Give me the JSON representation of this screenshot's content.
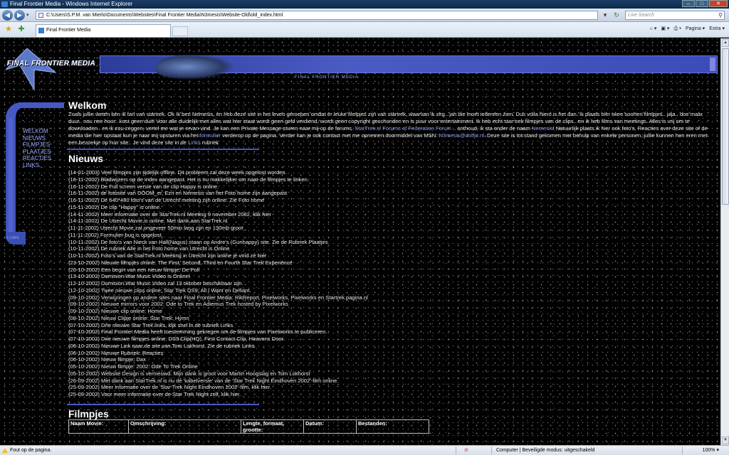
{
  "window": {
    "title": "Final Frontier Media - Windows Internet Explorer",
    "min": "–",
    "max": "□",
    "close": "✕"
  },
  "address": {
    "url": "C:\\Users\\S.P.M. van Mierlo\\Documents\\Websites\\Final Frontier Media\\N3mesis\\Website-Old\\old_index.html",
    "search_placeholder": "Live Search"
  },
  "tab": {
    "label": "Final Frontier Media"
  },
  "tools": {
    "page": "Pagina ▾",
    "extra": "Extra ▾"
  },
  "site": {
    "logo_text": "FINAL FRONTIER MEDIA",
    "banner_text": "FINAL FRONTIER MEDIA",
    "nav": [
      "WELKOM",
      "NIEUWS",
      "FILMPJES",
      "PLAATJES",
      "REACTIES",
      "LINKS"
    ],
    "lcars_label": "LCARS"
  },
  "welkom": {
    "title": "Welkom",
    "text1": "Zoals jullie weten ben ik fan van startrek. Ok Ik ben Nemesis, en heb deze site in het leven geroepen omdat er leuke filmpjes zijn van startrek, waarvan ik zeg.. jah die moet iedereen zien. Dus voila hiero is het dan. Ik plaats hier twee soorten filmpjes.. jaja.. doe maar duur.. nou nee hoor.. kost geen duit! Voor alle duidelijk met alles wat hier staat wordt geen geld verdiend, wordt geen copyright geschonden en is puur voor entertainment. Ik heb echt star trek filmpjes van de clips.. en ik heb films van meetings. Alles is vrij om te downloaden.. en ik zou zeggen, vertel me wat je ervan vind. Je kan een Private Message sturen naar mij op de forums. ",
    "link1": "StarTrek.nl Forums of Federation Forum",
    "text2": " .. onthoud, ik sta onder de naam ",
    "link2": "Nemesis",
    "text3": "! Natuurlijk plaats ik hier ook foto's. Reacties over deze site of de media die hier opstaat kun je naar mij opsturen via het ",
    "link3": "formulier",
    "text4": " verderop op de pagina. Verder kan je ook contact met me opnemen doormiddel van MSN: ",
    "link4": "N3mesis@dolfjn.nl",
    "text5": ". Deze site is tot stand gekomen met behulp van enkele personen, jullie kunnen hen eren met een bezoekje op hun site.. Je vind deze site in de ",
    "link5": "Links",
    "text6": " rubriek"
  },
  "nieuws": {
    "title": "Nieuws",
    "items": [
      "(14-01-2003) Veel filmpjes zijn tijdelijk offline. Dit probleem zal deze week opgelost worden.",
      "(16-11-2002) Bladwijzers op de index aangepast. Het is nu makkelijker om naar de filmpjes te linken.",
      "(16-11-2002) De Full screen versie van de clip Happy is online.",
      "(16-11-2002) de fotosite van DOOM_er, Ezri en Nemesis van het Foto home zijn aangepast",
      "(16-11-2002) De 640*480 foto's van de Utrecht meeting zijn online. Zie Foto home",
      "(15-11-2002) De clip \"Happy\" is online.",
      "(14-11-2002) Meer informatie over de StarTrek.nl Meeting 9 november 2002, klik hier",
      "(14-11-2002) De Utrecht Movie is online. Met dank aan StarTrek.nl",
      "(11-11-2002) Utrecht Movie zal ongeveer 50min lang zijn en 130mb groot",
      "(11-11-2002) Formulier-bug is opgelost.",
      "(10-11-2002) De foto's van Nieck van Hall(Nagus) staan op Andre's (Gunhappy) site. Zie de Rubriek Plaatjes",
      "(10-11-2002) De rubriek Alle in het Foto home van Utrecht is Online",
      "(10-11-2002) Foto's van de StarTrek.nl Meeting in Utrecht zijn online je vind ze hier",
      "(23-10-2002) Nieuwe filmpjes online: The First, Second, Third en Fourth Star Trek Experience",
      "(20-10-2002) Een begin van een nieuw filmpje: De Poll",
      "(13-10-2002) Dominion War Music Video is Online!",
      "(12-10-2002) Dominion War Music Video zal 13 oktober beschikbaar zijn.",
      "(12-10-2002) Twee nieuwe clips online: Star Trek DS9: All I Want en Defiant.",
      "(09-10-2002) Verwijzingen op andere sites naar Final Frontier Media: RikReport, Pixelworks, Pixelworks en Startrek.pagina.nl",
      "(09-10-2002) Nieuwe mirrors voor 2002: Ode to Trek en Adiemus Trek hosted by Pixelworks",
      "(09-10-2002) Nieuwe clip online: Home",
      "(08-10-2002) Nieuw Clipje online: Star Trek: Hymn",
      "(07-10-2002) Drie nieuwe Star Trek links, kijk snel in de rubriek Links",
      "(07-10-2002) Final Frontier Media heeft toestemming gekregen om de filmpjes van Pixelworks te publiceren.",
      "(07-10-2002) Drie nieuwe filmpjes online: DS9 Clip(HQ), First Contact Clip, Heavens Door.",
      "(06-10-2002) Nieuwe Link naar de site van Tom Lokhorst. Zie de rubriek Links",
      "(06-10-2002) Nieuwe Rubriek: Reacties",
      "(06-10-2002) Nieuw filmpje: Dax",
      "(05-10-2002) Nieuw filmpje: 2002: Ode To Trek Online",
      "(05-10-2002) Website Design is vernieuwd. Mijn dank is groot voor Martin Hoogslag en Tom Lokhorst",
      "(26-09-2002) Met dank aan StarTrek.nl is nu de 'kabelversie' van de 'Star Trek Night Eindhoven 2002'-film online.",
      "(25-09-2002) Meer informatie over de 'Star Trek Night Eindhoven 2002'-film, klik hier.",
      "(25-09-2002) Voor meer informatie over de Star Trek Night zelf, klik hier."
    ]
  },
  "filmpjes": {
    "title": "Filmpjes",
    "columns": [
      "Naam Movie:",
      "Omschrijving:",
      "Lengte, formaat, grootte:",
      "Datum:",
      "Bestanden:"
    ]
  },
  "status": {
    "message": "Fout op de pagina.",
    "zone": "Computer | Beveiligde modus: uitgeschakeld",
    "zoom": "100% ▾"
  }
}
